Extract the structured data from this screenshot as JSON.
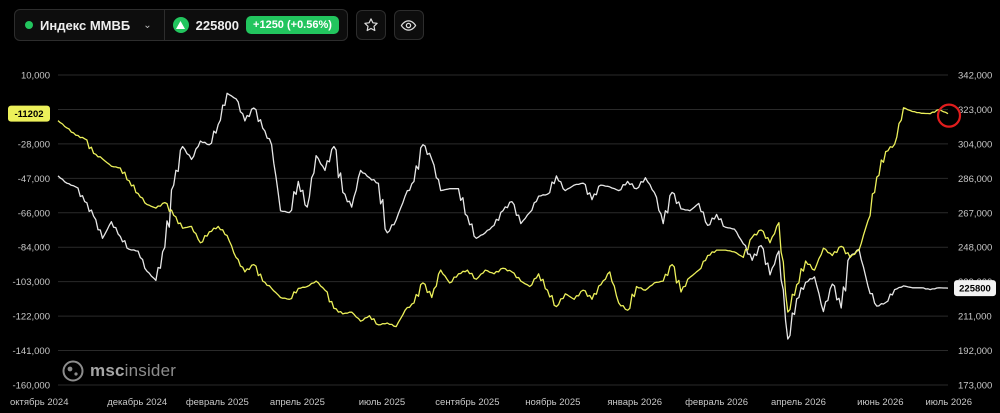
{
  "header": {
    "instrument": "Индекс ММВБ",
    "price": "225800",
    "change": "+1250 (+0.56%)"
  },
  "watermark": {
    "bold": "msc",
    "rest": "insider"
  },
  "colors": {
    "up": "#22c55e",
    "right_series": "#e6e6e6",
    "left_series": "#ecf05a",
    "grid": "#2a2a2a"
  },
  "chart_data": {
    "type": "line",
    "x_labels": [
      "октябрь 2024",
      "декабрь 2024",
      "февраль 2025",
      "апрель 2025",
      "июль 2025",
      "сентябрь 2025",
      "ноябрь 2025",
      "январь 2026",
      "февраль 2026",
      "апрель 2026",
      "июнь 2026",
      "июль 2026"
    ],
    "x_range": [
      0,
      100
    ],
    "x_label_positions": [
      0,
      8.9,
      17.9,
      26.9,
      36.4,
      46.0,
      55.6,
      64.8,
      74.0,
      83.2,
      92.4,
      100
    ],
    "left_axis": {
      "ticks": [
        "10,000",
        "-9,000",
        "-28,000",
        "-47,000",
        "-66,000",
        "-84,000",
        "-103,000",
        "-122,000",
        "-141,000",
        "-160,000"
      ],
      "ylim": [
        -160000,
        10000
      ]
    },
    "right_axis": {
      "ticks": [
        "342,000",
        "323,000",
        "304,000",
        "286,000",
        "267,000",
        "248,000",
        "229,000",
        "211,000",
        "192,000",
        "173,000"
      ],
      "ylim": [
        173000,
        342000
      ]
    },
    "left_marker": "-11202",
    "right_marker": "225800",
    "series": [
      {
        "axis": "right",
        "color": "#e6e6e6",
        "points": [
          [
            0,
            287
          ],
          [
            1,
            283
          ],
          [
            2,
            281
          ],
          [
            3,
            273
          ],
          [
            4,
            265
          ],
          [
            5,
            253
          ],
          [
            6,
            262
          ],
          [
            7,
            254
          ],
          [
            8,
            247
          ],
          [
            9,
            246
          ],
          [
            10,
            235
          ],
          [
            11,
            230
          ],
          [
            12,
            248
          ],
          [
            13,
            282
          ],
          [
            14,
            303
          ],
          [
            15,
            296
          ],
          [
            16,
            306
          ],
          [
            17,
            304
          ],
          [
            18,
            315
          ],
          [
            19,
            332
          ],
          [
            20,
            329
          ],
          [
            21,
            317
          ],
          [
            22,
            324
          ],
          [
            23,
            313
          ],
          [
            24,
            304
          ],
          [
            25,
            268
          ],
          [
            26,
            267
          ],
          [
            27,
            284
          ],
          [
            28,
            270
          ],
          [
            29,
            298
          ],
          [
            30,
            290
          ],
          [
            31,
            303
          ],
          [
            32,
            278
          ],
          [
            33,
            270
          ],
          [
            34,
            290
          ],
          [
            35,
            286
          ],
          [
            36,
            283
          ],
          [
            37,
            256
          ],
          [
            38,
            263
          ],
          [
            39,
            276
          ],
          [
            40,
            284
          ],
          [
            41,
            304
          ],
          [
            42,
            296
          ],
          [
            43,
            279
          ],
          [
            44,
            280
          ],
          [
            45,
            280
          ],
          [
            46,
            265
          ],
          [
            47,
            253
          ],
          [
            48,
            256
          ],
          [
            49,
            260
          ],
          [
            50,
            268
          ],
          [
            51,
            273
          ],
          [
            52,
            261
          ],
          [
            53,
            267
          ],
          [
            54,
            276
          ],
          [
            55,
            277
          ],
          [
            56,
            287
          ],
          [
            57,
            279
          ],
          [
            58,
            282
          ],
          [
            59,
            283
          ],
          [
            60,
            274
          ],
          [
            61,
            282
          ],
          [
            62,
            281
          ],
          [
            63,
            279
          ],
          [
            64,
            284
          ],
          [
            65,
            280
          ],
          [
            66,
            286
          ],
          [
            67,
            278
          ],
          [
            68,
            261
          ],
          [
            69,
            278
          ],
          [
            70,
            269
          ],
          [
            71,
            268
          ],
          [
            72,
            272
          ],
          [
            73,
            260
          ],
          [
            74,
            266
          ],
          [
            75,
            259
          ],
          [
            76,
            258
          ],
          [
            77,
            250
          ],
          [
            78,
            241
          ],
          [
            79,
            249
          ],
          [
            80,
            233
          ],
          [
            81,
            246
          ],
          [
            82,
            198
          ],
          [
            83,
            220
          ],
          [
            84,
            229
          ],
          [
            85,
            232
          ],
          [
            86,
            213
          ],
          [
            87,
            228
          ],
          [
            88,
            215
          ],
          [
            89,
            243
          ],
          [
            90,
            247
          ],
          [
            91,
            227
          ],
          [
            92,
            216
          ],
          [
            93,
            218
          ],
          [
            94,
            225
          ],
          [
            95,
            227
          ],
          [
            96,
            226
          ],
          [
            97,
            226
          ],
          [
            98,
            225
          ],
          [
            99,
            226
          ],
          [
            100,
            225.8
          ]
        ]
      },
      {
        "axis": "left",
        "color": "#ecf05a",
        "points": [
          [
            0,
            -15000
          ],
          [
            1,
            -19000
          ],
          [
            2,
            -23000
          ],
          [
            3,
            -25000
          ],
          [
            4,
            -33000
          ],
          [
            5,
            -36000
          ],
          [
            6,
            -40000
          ],
          [
            7,
            -41000
          ],
          [
            8,
            -48000
          ],
          [
            9,
            -55000
          ],
          [
            10,
            -61000
          ],
          [
            11,
            -63000
          ],
          [
            12,
            -60000
          ],
          [
            13,
            -67000
          ],
          [
            14,
            -74000
          ],
          [
            15,
            -73000
          ],
          [
            16,
            -82000
          ],
          [
            17,
            -76000
          ],
          [
            18,
            -73000
          ],
          [
            19,
            -78000
          ],
          [
            20,
            -90000
          ],
          [
            21,
            -98000
          ],
          [
            22,
            -94000
          ],
          [
            23,
            -103000
          ],
          [
            24,
            -107000
          ],
          [
            25,
            -112000
          ],
          [
            26,
            -113000
          ],
          [
            27,
            -107000
          ],
          [
            28,
            -106000
          ],
          [
            29,
            -103000
          ],
          [
            30,
            -108000
          ],
          [
            31,
            -118000
          ],
          [
            32,
            -121000
          ],
          [
            33,
            -120000
          ],
          [
            34,
            -125000
          ],
          [
            35,
            -122000
          ],
          [
            36,
            -127000
          ],
          [
            37,
            -126000
          ],
          [
            38,
            -128000
          ],
          [
            39,
            -119000
          ],
          [
            40,
            -115000
          ],
          [
            41,
            -104000
          ],
          [
            42,
            -112000
          ],
          [
            43,
            -97000
          ],
          [
            44,
            -104000
          ],
          [
            45,
            -99000
          ],
          [
            46,
            -97000
          ],
          [
            47,
            -102000
          ],
          [
            48,
            -97000
          ],
          [
            49,
            -99000
          ],
          [
            50,
            -96000
          ],
          [
            51,
            -98000
          ],
          [
            52,
            -103000
          ],
          [
            53,
            -106000
          ],
          [
            54,
            -99000
          ],
          [
            55,
            -108000
          ],
          [
            56,
            -117000
          ],
          [
            57,
            -110000
          ],
          [
            58,
            -113000
          ],
          [
            59,
            -108000
          ],
          [
            60,
            -113000
          ],
          [
            61,
            -105000
          ],
          [
            62,
            -98000
          ],
          [
            63,
            -115000
          ],
          [
            64,
            -119000
          ],
          [
            65,
            -106000
          ],
          [
            66,
            -108000
          ],
          [
            67,
            -104000
          ],
          [
            68,
            -103000
          ],
          [
            69,
            -94000
          ],
          [
            70,
            -109000
          ],
          [
            71,
            -101000
          ],
          [
            72,
            -97000
          ],
          [
            73,
            -89000
          ],
          [
            74,
            -86000
          ],
          [
            75,
            -86000
          ],
          [
            76,
            -87000
          ],
          [
            77,
            -90000
          ],
          [
            78,
            -79000
          ],
          [
            79,
            -75000
          ],
          [
            80,
            -82000
          ],
          [
            81,
            -71000
          ],
          [
            82,
            -120000
          ],
          [
            83,
            -105000
          ],
          [
            84,
            -92000
          ],
          [
            85,
            -97000
          ],
          [
            86,
            -85000
          ],
          [
            87,
            -89000
          ],
          [
            88,
            -84000
          ],
          [
            89,
            -90000
          ],
          [
            90,
            -86000
          ],
          [
            91,
            -70000
          ],
          [
            92,
            -46000
          ],
          [
            93,
            -32000
          ],
          [
            94,
            -28000
          ],
          [
            95,
            -8000
          ],
          [
            96,
            -10000
          ],
          [
            97,
            -11000
          ],
          [
            98,
            -11202
          ],
          [
            99,
            -9000
          ],
          [
            100,
            -11202
          ]
        ]
      }
    ]
  }
}
